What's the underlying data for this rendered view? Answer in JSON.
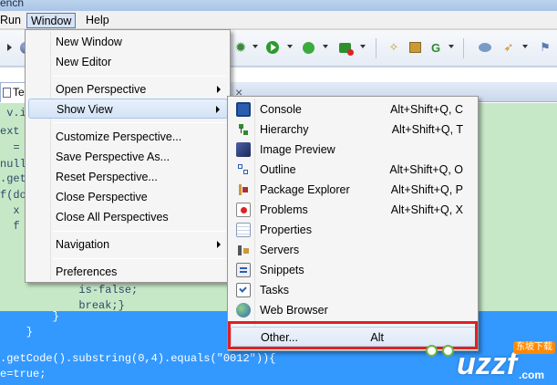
{
  "window": {
    "title_fragment": "ench"
  },
  "menubar": {
    "items": [
      "Run",
      "Window",
      "Help"
    ]
  },
  "editor": {
    "tab_label": "Te",
    "tab_close": "×",
    "code_lines": [
      " v.i",
      "ext ",
      "  = ",
      "null",
      ".get",
      "f(do",
      "  x",
      "  f",
      "",
      "",
      "",
      "            is-false;",
      "            break;}",
      "        }",
      "    }",
      ".getCode().substring(0,4).equals(\"0012\")){",
      "e=true;"
    ]
  },
  "window_menu": {
    "items": [
      {
        "label": "New Window",
        "has_submenu": false
      },
      {
        "label": "New Editor",
        "has_submenu": false
      },
      {
        "label": "Open Perspective",
        "has_submenu": true
      },
      {
        "label": "Show View",
        "has_submenu": true,
        "highlighted": true
      },
      {
        "label": "Customize Perspective...",
        "has_submenu": false
      },
      {
        "label": "Save Perspective As...",
        "has_submenu": false
      },
      {
        "label": "Reset Perspective...",
        "has_submenu": false
      },
      {
        "label": "Close Perspective",
        "has_submenu": false
      },
      {
        "label": "Close All Perspectives",
        "has_submenu": false
      },
      {
        "label": "Navigation",
        "has_submenu": true
      },
      {
        "label": "Preferences",
        "has_submenu": false
      }
    ]
  },
  "show_view_menu": {
    "items": [
      {
        "label": "Console",
        "shortcut": "Alt+Shift+Q, C",
        "icon": "console-icon"
      },
      {
        "label": "Hierarchy",
        "shortcut": "Alt+Shift+Q, T",
        "icon": "hierarchy-icon"
      },
      {
        "label": "Image Preview",
        "shortcut": "",
        "icon": "image-preview-icon"
      },
      {
        "label": "Outline",
        "shortcut": "Alt+Shift+Q, O",
        "icon": "outline-icon"
      },
      {
        "label": "Package Explorer",
        "shortcut": "Alt+Shift+Q, P",
        "icon": "package-explorer-icon"
      },
      {
        "label": "Problems",
        "shortcut": "Alt+Shift+Q, X",
        "icon": "problems-icon"
      },
      {
        "label": "Properties",
        "shortcut": "",
        "icon": "properties-icon"
      },
      {
        "label": "Servers",
        "shortcut": "",
        "icon": "servers-icon"
      },
      {
        "label": "Snippets",
        "shortcut": "",
        "icon": "snippets-icon"
      },
      {
        "label": "Tasks",
        "shortcut": "",
        "icon": "tasks-icon"
      },
      {
        "label": "Web Browser",
        "shortcut": "",
        "icon": "web-browser-icon"
      },
      {
        "label": "Other...",
        "shortcut": "Alt",
        "icon": ""
      }
    ]
  },
  "watermark": {
    "text": "uzzf",
    "domain": ".com",
    "badge": "东坡下载"
  },
  "colors": {
    "highlight_border": "#e02020",
    "selection_blue": "#3399ff",
    "selection_green": "#c7e8c7"
  }
}
